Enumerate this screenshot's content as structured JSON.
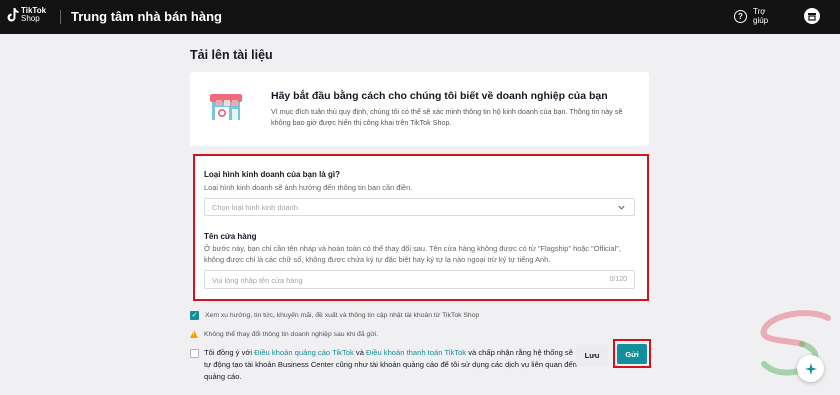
{
  "topbar": {
    "logo_line1": "TikTok",
    "logo_line2": "Shop",
    "title": "Trung tâm nhà bán hàng",
    "help_label": "Trợ giúp",
    "help_icon": "question-circle-icon",
    "store_icon": "store-icon"
  },
  "page": {
    "title": "Tải lên tài liệu"
  },
  "intro": {
    "title": "Hãy bắt đầu bằng cách cho chúng tôi biết về doanh nghiệp của bạn",
    "description": "Vì mục đích tuân thủ quy định, chúng tôi có thể sẽ xác minh thông tin hộ kinh doanh của bạn. Thông tin này sẽ không bao giờ được hiển thị công khai trên TikTok Shop."
  },
  "form": {
    "business_type_label": "Loại hình kinh doanh của bạn là gì?",
    "business_type_hint": "Loại hình kinh doanh sẽ ảnh hưởng đến thông tin bạn cần điền.",
    "business_type_placeholder": "Chọn loại hình kinh doanh",
    "shop_name_label": "Tên cửa hàng",
    "shop_name_hint": "Ở bước này, bạn chỉ cần tên nháp và hoàn toàn có thể thay đổi sau. Tên cửa hàng không được có từ \"Flagship\" hoặc \"Official\", không được chỉ là các chữ số, không được chứa ký tự đặc biệt hay ký tự lạ nào ngoại trừ ký tự tiếng Anh.",
    "shop_name_placeholder": "Vui lòng nhập tên cửa hàng",
    "shop_name_counter": "0/120"
  },
  "subscribe": {
    "checked": true,
    "text": "Xem xu hướng, tin tức, khuyến mãi, đề xuất và thông tin cập nhật tài khoản từ TikTok Shop"
  },
  "warning": {
    "text": "Không thể thay đổi thông tin doanh nghiệp sau khi đã gửi."
  },
  "agreement": {
    "checked": false,
    "prefix": "Tôi đồng ý với ",
    "link1": "Điều khoản quảng cáo TikTok",
    "middle": " và ",
    "link2": "Điều khoản thanh toán TikTok",
    "suffix": " và chấp nhận rằng hệ thống sẽ tự động tạo tài khoản Business Center cũng như tài khoản quảng cáo để tôi sử dụng các dịch vụ liên quan đến quảng cáo."
  },
  "actions": {
    "save_label": "Lưu",
    "submit_label": "Gửi"
  },
  "colors": {
    "accent": "#138f9c",
    "highlight": "#d0141b",
    "topbar": "#121212",
    "warning": "#f7a100"
  }
}
